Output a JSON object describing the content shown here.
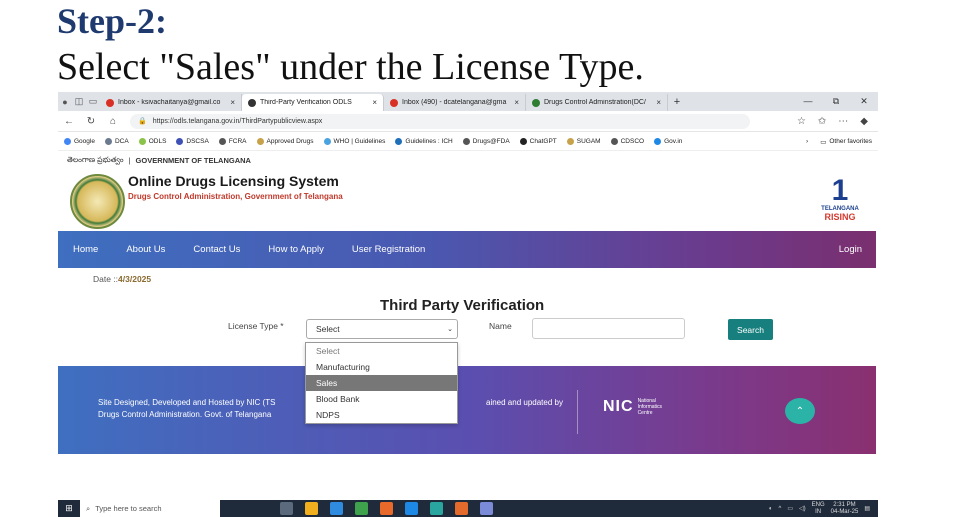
{
  "heading": {
    "step": "Step-2:",
    "instruction": "Select \"Sales\" under the License Type."
  },
  "browser": {
    "tabs": [
      {
        "label": "Inbox - ksivachaitanya@gmail.co",
        "fav_color": "#d93025"
      },
      {
        "label": "Third-Party Verification ODLS",
        "fav_color": "#333333"
      },
      {
        "label": "Inbox (490) - dcatelangana@gma",
        "fav_color": "#d93025"
      },
      {
        "label": "Drugs Control Adminstration(DC/",
        "fav_color": "#2e7d32"
      }
    ],
    "url": "https://odls.telangana.gov.in/ThirdPartypublicview.aspx",
    "bookmarks": [
      "Google",
      "DCA",
      "ODLS",
      "DSCSA",
      "FCRA",
      "Approved Drugs",
      "WHO | Guidelines",
      "Guidelines : ICH",
      "Drugs@FDA",
      "ChatGPT",
      "SUGAM",
      "CDSCO",
      "Gov.in"
    ],
    "other_favorites": "Other favorites"
  },
  "site": {
    "gov_telugu": "తెలంగాణ ప్రభుత్వం",
    "gov_english": "GOVERNMENT OF TELANGANA",
    "title": "Online Drugs Licensing System",
    "subtitle": "Drugs Control Administration, Government of Telangana",
    "rising_num": "1",
    "rising_top": "TELANGANA",
    "rising_bottom": "RISING"
  },
  "nav": {
    "items": [
      "Home",
      "About Us",
      "Contact Us",
      "How to Apply",
      "User Registration"
    ],
    "login": "Login"
  },
  "form": {
    "date_label": "Date ::",
    "date_value": "4/3/2025",
    "title": "Third Party Verification",
    "license_label": "License Type *",
    "license_selected": "Select",
    "name_label": "Name",
    "search_label": "Search",
    "options": [
      "Select",
      "Manufacturing",
      "Sales",
      "Blood Bank",
      "NDPS"
    ],
    "highlighted_option": "Sales"
  },
  "footer": {
    "line1": "Site Designed, Developed and Hosted by NIC (TS",
    "line2": "Drugs Control Administration. Govt. of Telangana",
    "line3": "ained and updated by",
    "nic": "NIC",
    "nic_sub1": "National",
    "nic_sub2": "Informatics",
    "nic_sub3": "Centre"
  },
  "taskbar": {
    "search_placeholder": "Type here to search",
    "lang": "ENG",
    "lang2": "IN",
    "time": "2:31 PM",
    "date": "04-Mar-25"
  }
}
